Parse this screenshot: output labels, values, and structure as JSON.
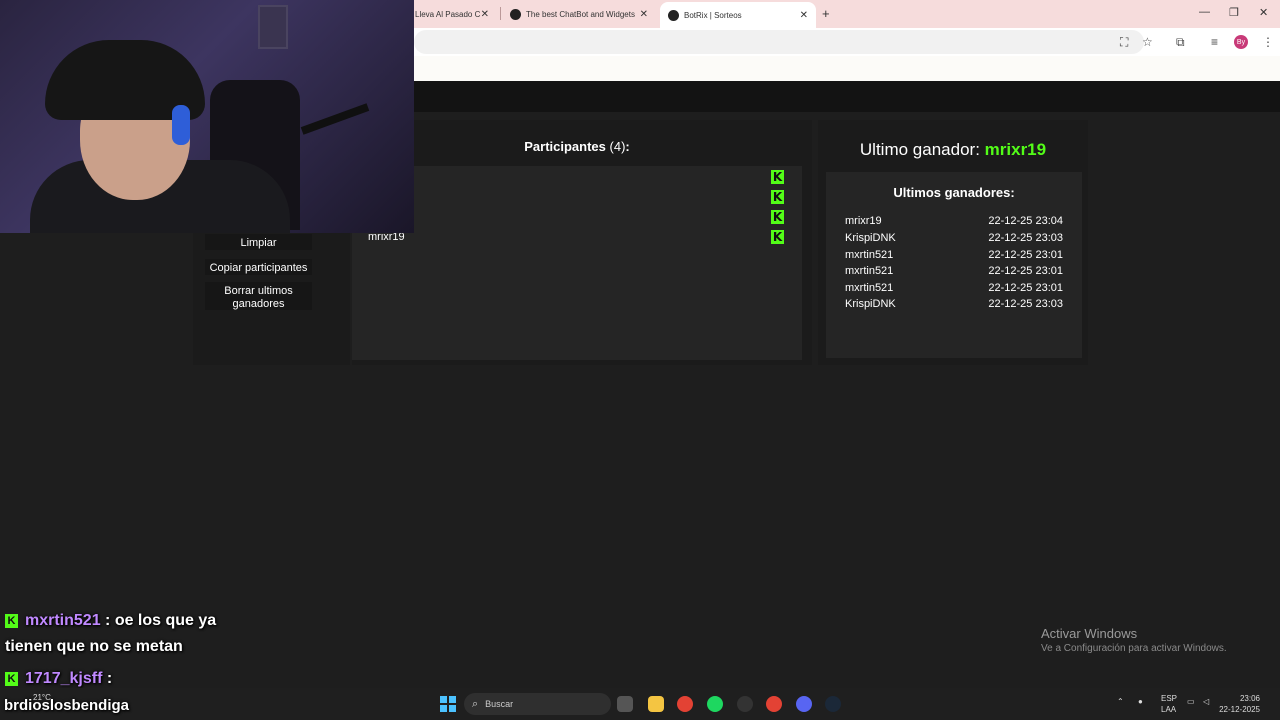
{
  "browser": {
    "tabs": [
      {
        "title": "Lleva Al Pasado C"
      },
      {
        "title": "The best ChatBot and Widgets"
      },
      {
        "title": "BotRix | Sorteos"
      }
    ],
    "new_tab_glyph": "+",
    "close_glyph": "✕",
    "profile_initials": "By"
  },
  "sidebar": {
    "buttons": [
      {
        "label": "Limpiar"
      },
      {
        "label": "Copiar participantes"
      },
      {
        "label": "Borrar ultimos ganadores"
      }
    ]
  },
  "participants": {
    "title": "Participantes",
    "count": "(4)",
    "colon": ":",
    "visible_name": "mrixr19",
    "badge_glyph": "K",
    "rows": 4
  },
  "winners": {
    "last_winner_label": "Ultimo ganador:",
    "last_winner_name": "mrixr19",
    "list_title": "Ultimos ganadores:",
    "list": [
      {
        "name": "mrixr19",
        "time": "22-12-25 23:04"
      },
      {
        "name": "KrispiDNK",
        "time": "22-12-25 23:03"
      },
      {
        "name": "mxrtin521",
        "time": "22-12-25 23:01"
      },
      {
        "name": "mxrtin521",
        "time": "22-12-25 23:01"
      },
      {
        "name": "mxrtin521",
        "time": "22-12-25 23:01"
      },
      {
        "name": "KrispiDNK",
        "time": "22-12-25 23:03"
      }
    ]
  },
  "chat": {
    "messages": [
      {
        "user": "mxrtin521",
        "text": " : oe los que ya",
        "text_cont": "tienen que no se metan"
      },
      {
        "user": "1717_kjsff",
        "text": " :"
      }
    ],
    "footer_text": "brdioslosbendiga"
  },
  "watermark": {
    "title": "Activar Windows",
    "subtitle": "Ve a Configuración para activar Windows."
  },
  "taskbar": {
    "search_placeholder": "Buscar",
    "weather": "21°C",
    "lang_top": "ESP",
    "lang_bottom": "LAA",
    "time": "23:06",
    "date": "22-12-2025"
  },
  "colors": {
    "kick_green": "#53fc18",
    "chat_user": "#c089ff",
    "panel_bg": "#1b1b1b"
  }
}
